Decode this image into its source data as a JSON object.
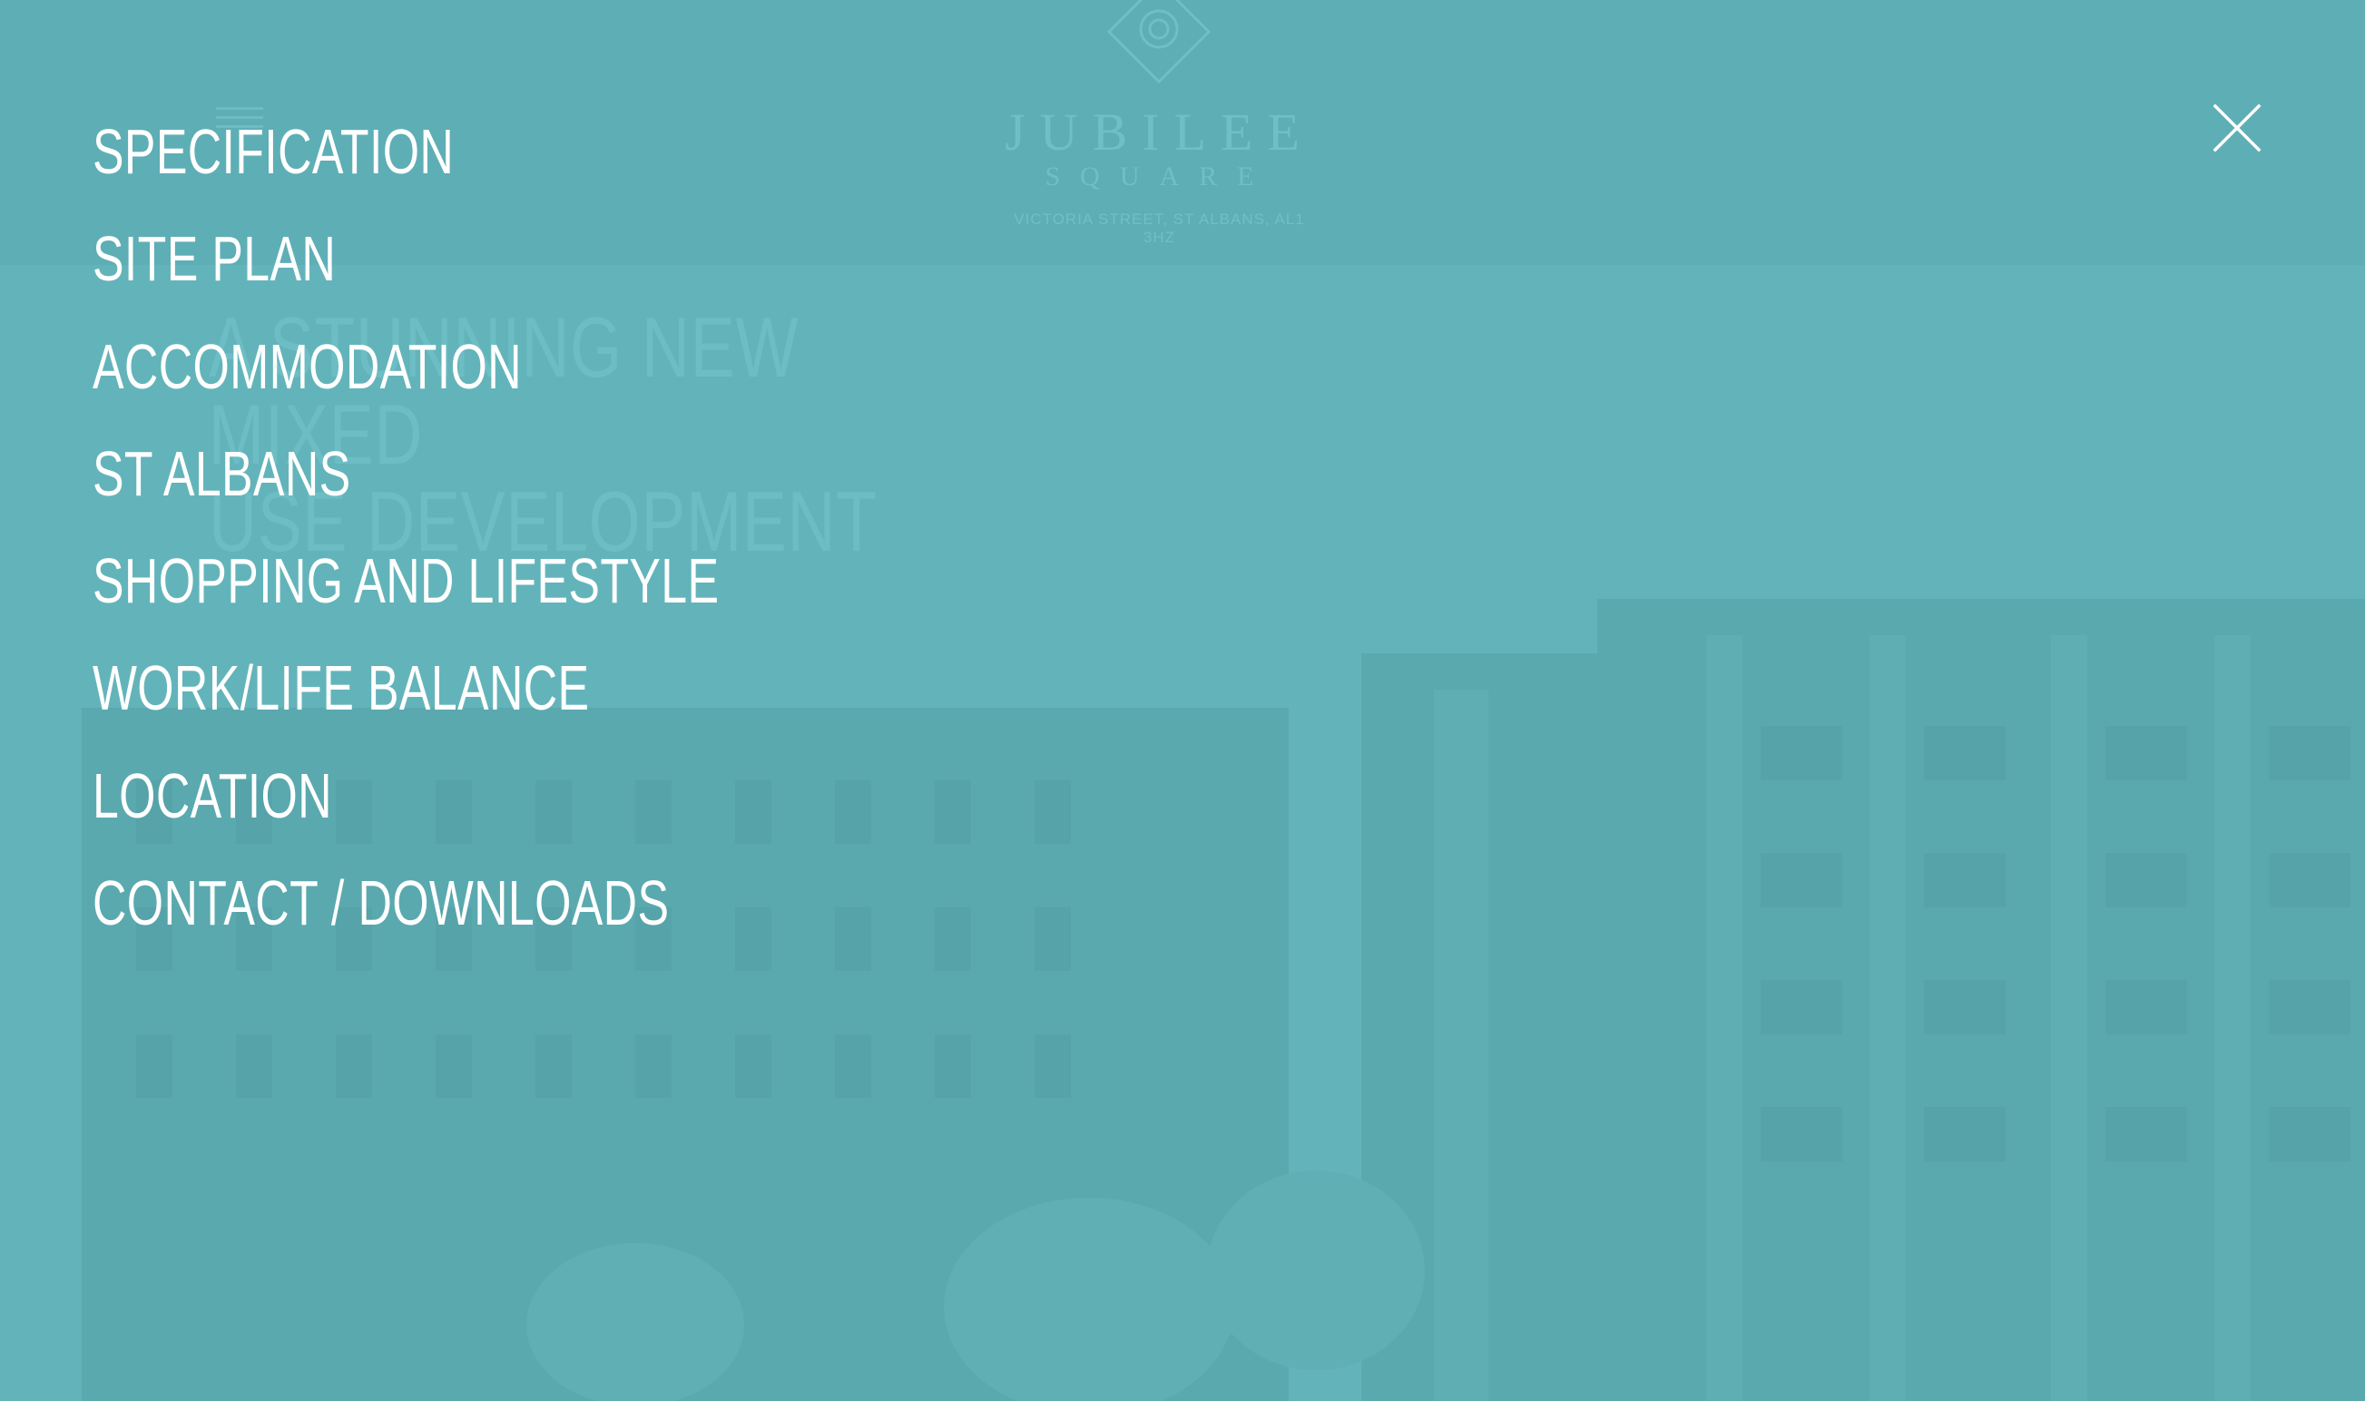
{
  "background": {
    "logo": {
      "name": "JUBILEE",
      "subname": "SQUARE",
      "address": "VICTORIA STREET, ST ALBANS, AL1 3HZ"
    },
    "hero": {
      "title_line1": "A STUNNING NEW MIXED",
      "title_line2": "USE DEVELOPMENT"
    }
  },
  "menu": {
    "items": [
      {
        "label": "SPECIFICATION"
      },
      {
        "label": "SITE PLAN"
      },
      {
        "label": "ACCOMMODATION"
      },
      {
        "label": "ST ALBANS"
      },
      {
        "label": "SHOPPING AND LIFESTYLE"
      },
      {
        "label": "WORK/LIFE BALANCE"
      },
      {
        "label": "LOCATION"
      },
      {
        "label": "CONTACT / DOWNLOADS"
      }
    ],
    "close_icon": "close-icon"
  },
  "colors": {
    "overlay": "#63b4ba",
    "text": "#ffffff",
    "faded": "#6fbcc2"
  }
}
